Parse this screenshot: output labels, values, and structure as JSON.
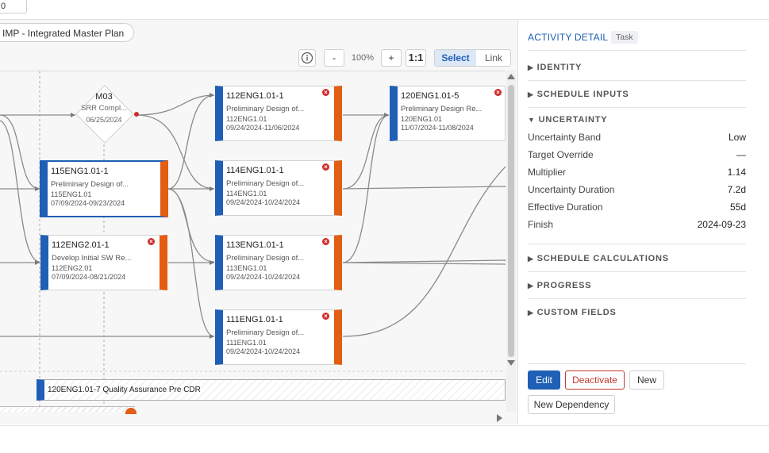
{
  "top": {
    "input_value": "0"
  },
  "toolbar": {
    "plan_label": "IMP - Integrated Master Plan",
    "info_icon": "info-icon",
    "zoom_out": "-",
    "zoom_level": "100%",
    "zoom_in": "+",
    "actual_size": "1:1",
    "select_label": "Select",
    "link_label": "Link"
  },
  "milestone": {
    "code": "M03",
    "name": "SRR Compl...",
    "date": "06/25/2024"
  },
  "cards": [
    {
      "code": "112ENG1.01-1",
      "desc": "Preliminary Design of...",
      "wbs": "112ENG1.01",
      "dates": "09/24/2024-11/06/2024"
    },
    {
      "code": "120ENG1.01-5",
      "desc": "Preliminary Design Re...",
      "wbs": "120ENG1.01",
      "dates": "11/07/2024-11/08/2024"
    },
    {
      "code": "115ENG1.01-1",
      "desc": "Preliminary Design of...",
      "wbs": "115ENG1.01",
      "dates": "07/09/2024-09/23/2024"
    },
    {
      "code": "114ENG1.01-1",
      "desc": "Preliminary Design of...",
      "wbs": "114ENG1.01",
      "dates": "09/24/2024-10/24/2024"
    },
    {
      "code": "112ENG2.01-1",
      "desc": "Develop Initial SW Re...",
      "wbs": "112ENG2.01",
      "dates": "07/09/2024-08/21/2024"
    },
    {
      "code": "113ENG1.01-1",
      "desc": "Preliminary Design of...",
      "wbs": "113ENG1.01",
      "dates": "09/24/2024-10/24/2024"
    },
    {
      "code": "111ENG1.01-1",
      "desc": "Preliminary Design of...",
      "wbs": "111ENG1.01",
      "dates": "09/24/2024-10/24/2024"
    }
  ],
  "qa_bar": {
    "label": "120ENG1.01-7 Quality Assurance Pre CDR"
  },
  "detail": {
    "title": "ACTIVITY DETAIL",
    "badge": "Task",
    "sections": {
      "identity": "IDENTITY",
      "schedule_inputs": "SCHEDULE INPUTS",
      "uncertainty": "UNCERTAINTY",
      "schedule_calculations": "SCHEDULE CALCULATIONS",
      "progress": "PROGRESS",
      "custom_fields": "CUSTOM FIELDS"
    },
    "collapsed_arrow": "▶",
    "expanded_arrow": "▼",
    "rows": [
      {
        "label": "Uncertainty Band",
        "value": "Low"
      },
      {
        "label": "Target Override",
        "value": "—"
      },
      {
        "label": "Multiplier",
        "value": "1.14"
      },
      {
        "label": "Uncertainty Duration",
        "value": "7.2d"
      },
      {
        "label": "Effective Duration",
        "value": "55d"
      },
      {
        "label": "Finish",
        "value": "2024-09-23"
      }
    ],
    "buttons": {
      "edit": "Edit",
      "deactivate": "Deactivate",
      "new": "New",
      "new_dependency": "New Dependency"
    },
    "colors": {
      "accent": "#1f5fb5",
      "danger": "#c0392b",
      "task_end": "#e35d12"
    }
  }
}
